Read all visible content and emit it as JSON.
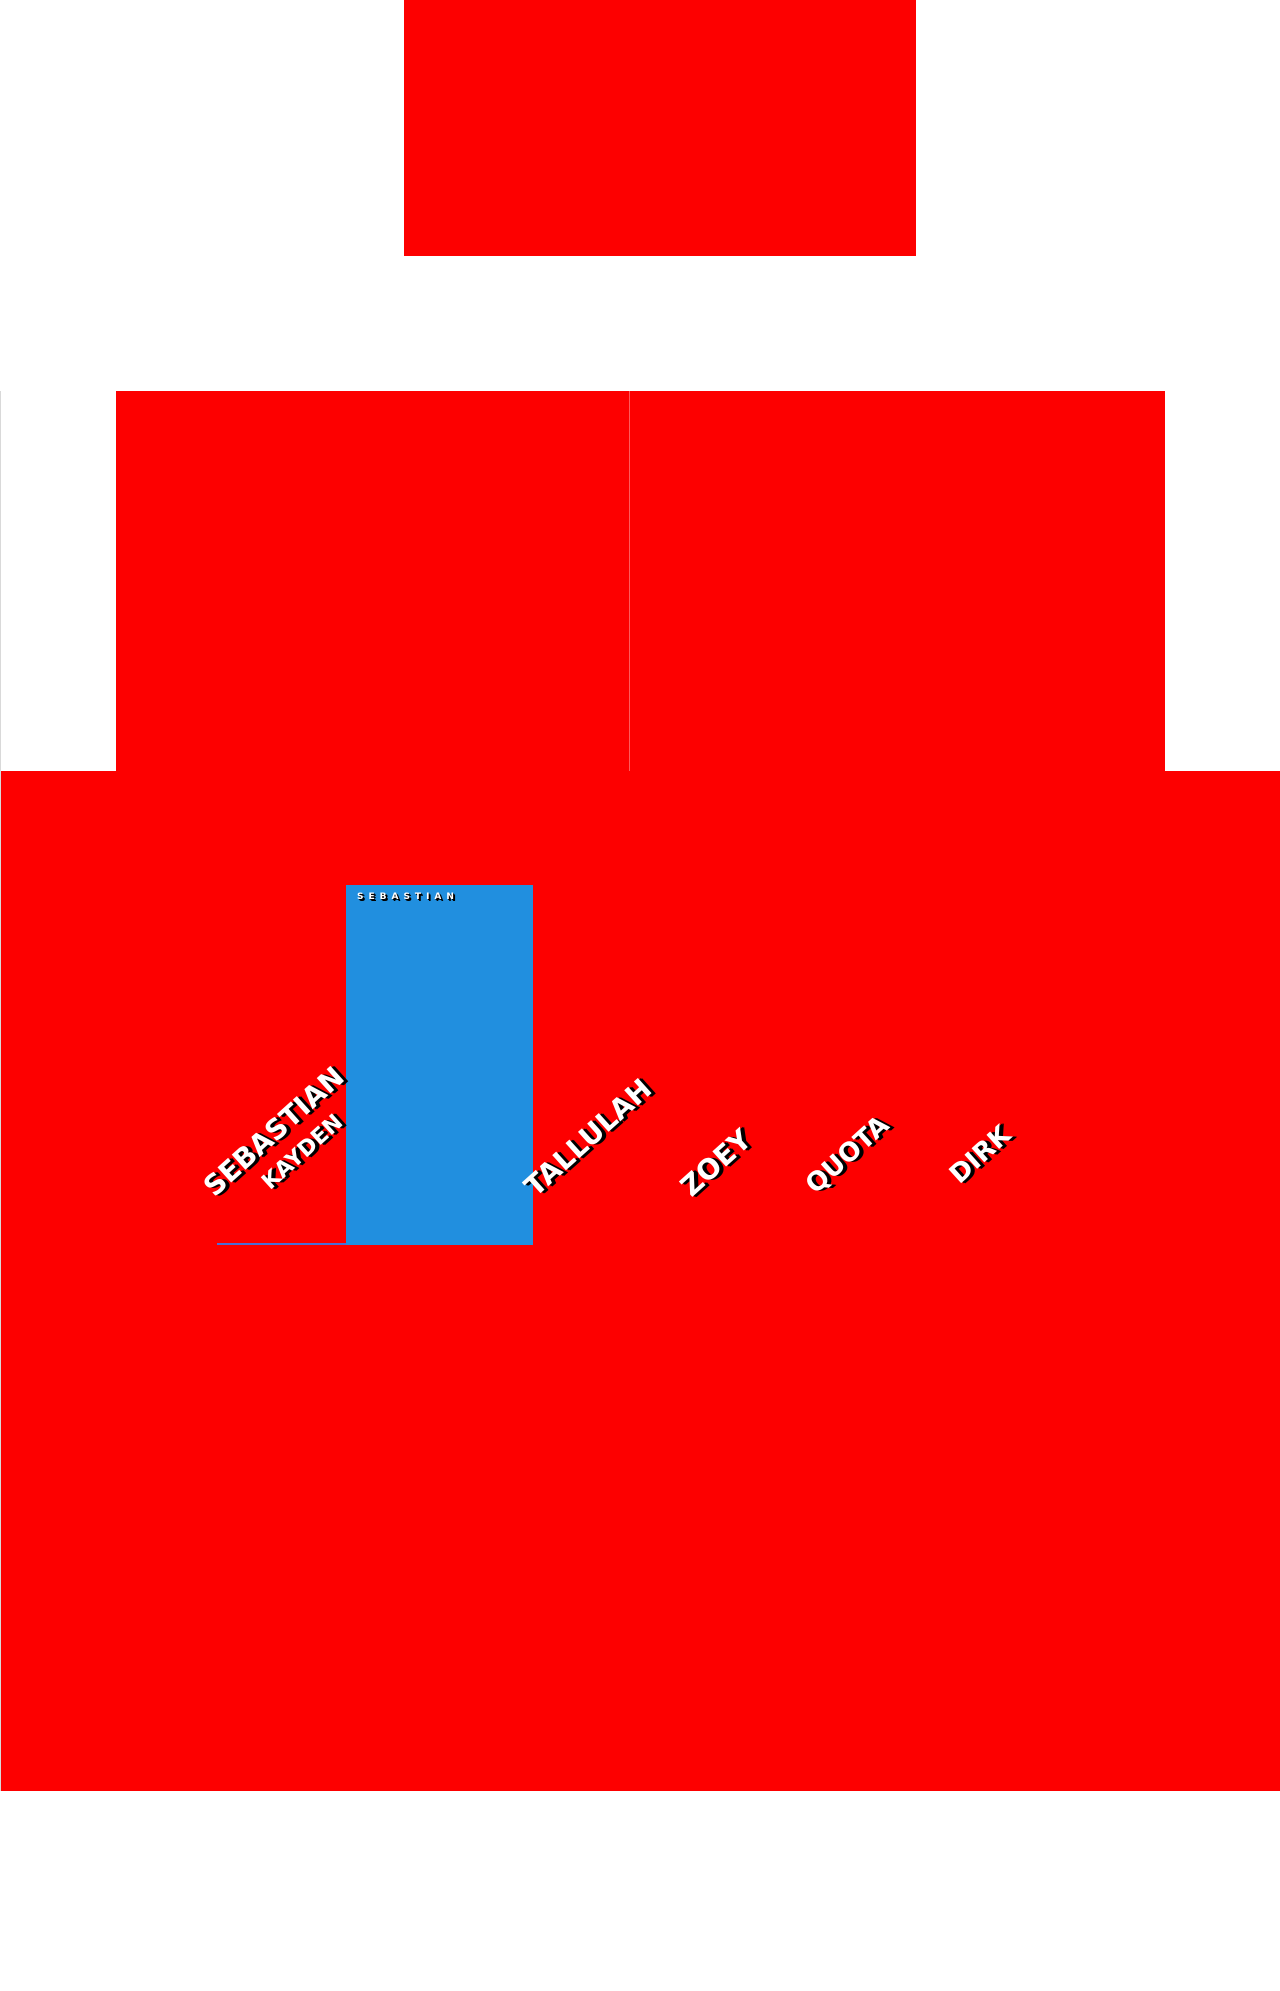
{
  "colors": {
    "brand_red": "#fd0000",
    "card_blue": "#218fdf",
    "background": "#ffffff"
  },
  "intro": {
    "line_one": "",
    "line_two": ""
  },
  "card": {
    "title": "SEBASTIAN",
    "body": ""
  },
  "names": [
    "SEBASTIAN",
    "KAYDEN",
    "TALLULAH",
    "ZOEY",
    "QUOTA",
    "DIRK"
  ]
}
